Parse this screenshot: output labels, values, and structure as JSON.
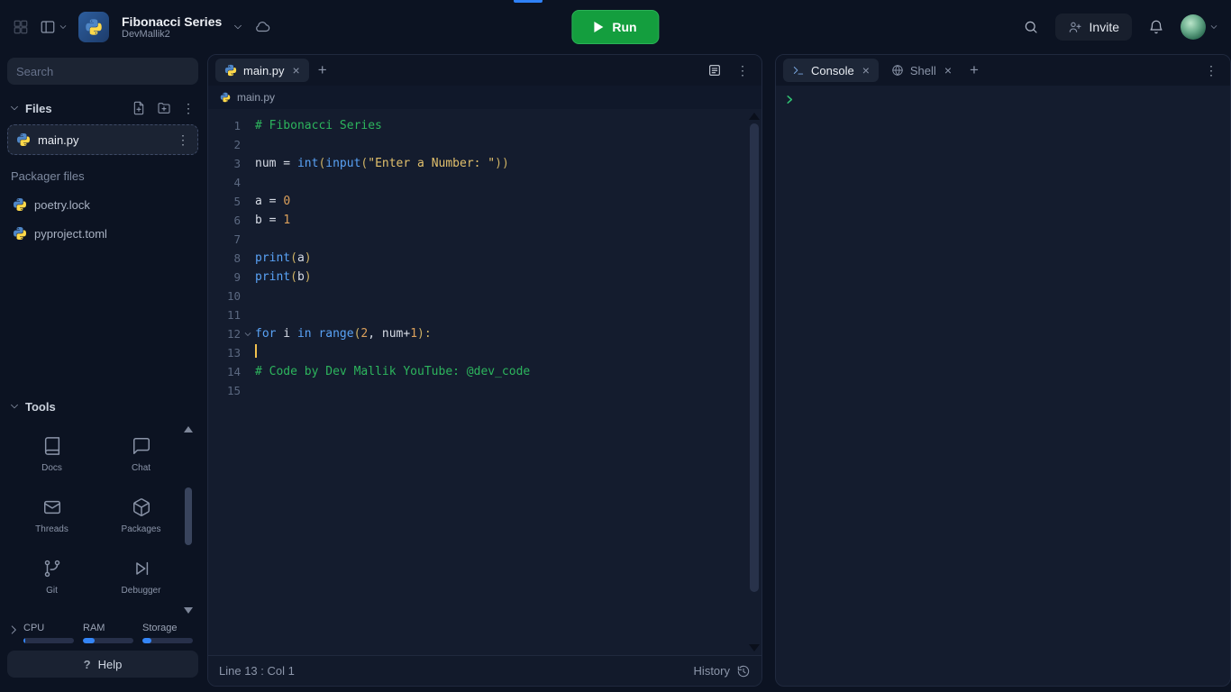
{
  "glyphs": {
    "close": "×",
    "plus": "+",
    "kebab": "⋮"
  },
  "colors": {
    "accent_green": "#149e3e",
    "accent_blue": "#2f81f7",
    "syntax_comment": "#2db55d",
    "syntax_keyword": "#59a2f5",
    "syntax_string": "#e2c06c",
    "syntax_number": "#dca05b",
    "syntax_bracket": "#cdb164",
    "syntax_text": "#d7dce6"
  },
  "topbar": {
    "title": "Fibonacci Series",
    "subtitle": "DevMallik2",
    "run_label": "Run",
    "invite_label": "Invite"
  },
  "sidebar": {
    "search_placeholder": "Search",
    "files_header": "Files",
    "file_items": [
      {
        "name": "main.py",
        "selected": true
      }
    ],
    "packager_header": "Packager files",
    "packager_items": [
      {
        "name": "poetry.lock"
      },
      {
        "name": "pyproject.toml"
      }
    ],
    "tools_header": "Tools",
    "tools": [
      {
        "label": "Docs",
        "icon": "docs-icon"
      },
      {
        "label": "Chat",
        "icon": "chat-icon"
      },
      {
        "label": "Threads",
        "icon": "threads-icon"
      },
      {
        "label": "Packages",
        "icon": "packages-icon"
      },
      {
        "label": "Git",
        "icon": "git-icon"
      },
      {
        "label": "Debugger",
        "icon": "debugger-icon"
      }
    ],
    "meters": [
      {
        "label": "CPU",
        "fill_pct": 3
      },
      {
        "label": "RAM",
        "fill_pct": 24
      },
      {
        "label": "Storage",
        "fill_pct": 18
      }
    ],
    "help_label": "Help"
  },
  "editor": {
    "tab_label": "main.py",
    "breadcrumb": "main.py",
    "cursor": {
      "line": 13,
      "col": 1
    },
    "status_position": "Line 13 : Col 1",
    "history_label": "History",
    "lines": [
      {
        "n": 1,
        "tokens": [
          [
            "com",
            "# Fibonacci Series"
          ]
        ]
      },
      {
        "n": 2,
        "tokens": []
      },
      {
        "n": 3,
        "tokens": [
          [
            "var",
            "num"
          ],
          [
            "op",
            " = "
          ],
          [
            "fn",
            "int"
          ],
          [
            "br",
            "("
          ],
          [
            "fn",
            "input"
          ],
          [
            "br",
            "("
          ],
          [
            "str",
            "\"Enter a Number: \""
          ],
          [
            "br",
            "))"
          ]
        ]
      },
      {
        "n": 4,
        "tokens": []
      },
      {
        "n": 5,
        "tokens": [
          [
            "var",
            "a"
          ],
          [
            "op",
            " = "
          ],
          [
            "num",
            "0"
          ]
        ]
      },
      {
        "n": 6,
        "tokens": [
          [
            "var",
            "b"
          ],
          [
            "op",
            " = "
          ],
          [
            "num",
            "1"
          ]
        ]
      },
      {
        "n": 7,
        "tokens": []
      },
      {
        "n": 8,
        "tokens": [
          [
            "fn",
            "print"
          ],
          [
            "br",
            "("
          ],
          [
            "var",
            "a"
          ],
          [
            "br",
            ")"
          ]
        ]
      },
      {
        "n": 9,
        "tokens": [
          [
            "fn",
            "print"
          ],
          [
            "br",
            "("
          ],
          [
            "var",
            "b"
          ],
          [
            "br",
            ")"
          ]
        ]
      },
      {
        "n": 10,
        "tokens": []
      },
      {
        "n": 11,
        "tokens": []
      },
      {
        "n": 12,
        "fold": true,
        "tokens": [
          [
            "kw",
            "for"
          ],
          [
            "var",
            " i "
          ],
          [
            "kw",
            "in"
          ],
          [
            "var",
            " "
          ],
          [
            "fn",
            "range"
          ],
          [
            "br",
            "("
          ],
          [
            "num",
            "2"
          ],
          [
            "op",
            ", "
          ],
          [
            "var",
            "num"
          ],
          [
            "op",
            "+"
          ],
          [
            "num",
            "1"
          ],
          [
            "br",
            "):"
          ]
        ]
      },
      {
        "n": 13,
        "cursor": true,
        "tokens": []
      },
      {
        "n": 14,
        "tokens": [
          [
            "com",
            "# Code by Dev Mallik YouTube: @dev_code"
          ]
        ]
      },
      {
        "n": 15,
        "tokens": []
      }
    ]
  },
  "console_pane": {
    "tabs": [
      {
        "label": "Console",
        "icon": "terminal-icon",
        "active": true
      },
      {
        "label": "Shell",
        "icon": "shell-icon",
        "active": false
      }
    ],
    "prompt_icon": "chevron-prompt-icon"
  }
}
